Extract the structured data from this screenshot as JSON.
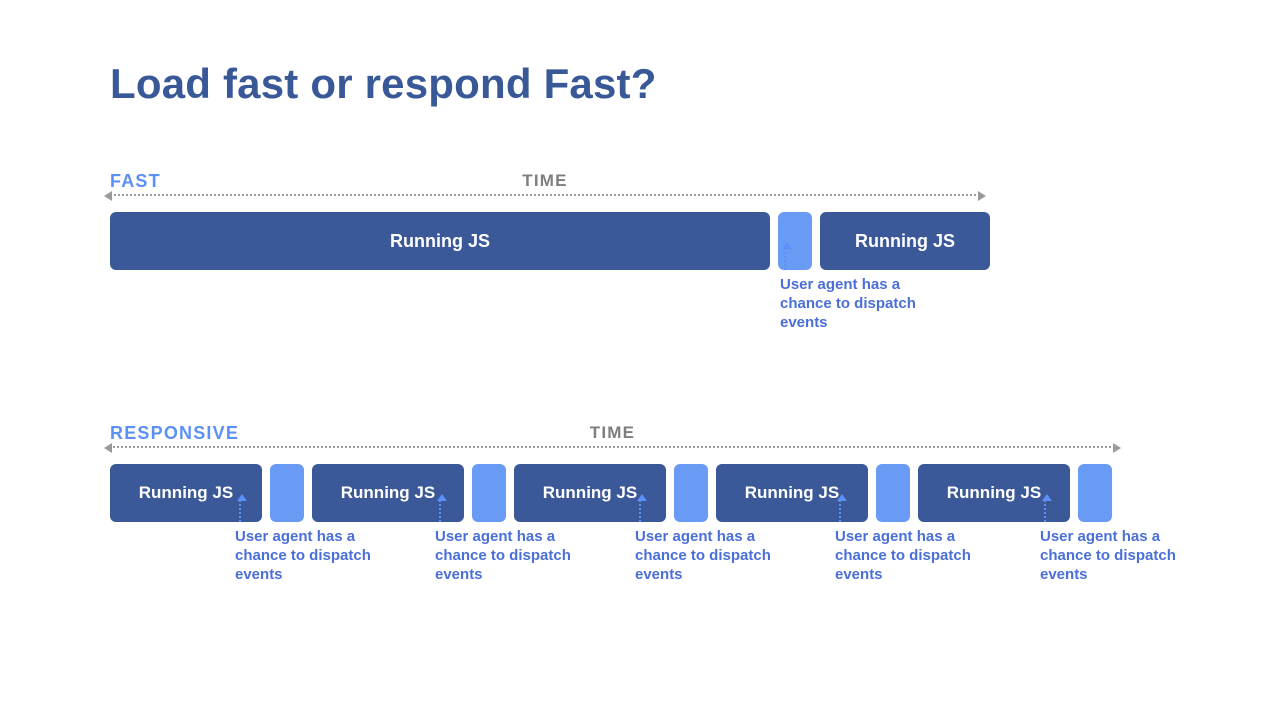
{
  "title": "Load fast or respond Fast?",
  "axis_label": "TIME",
  "block_label": "Running JS",
  "annotation_text": "User agent has a chance to dispatch events",
  "scenarios": {
    "fast": {
      "label": "FAST"
    },
    "responsive": {
      "label": "RESPONSIVE"
    }
  }
}
